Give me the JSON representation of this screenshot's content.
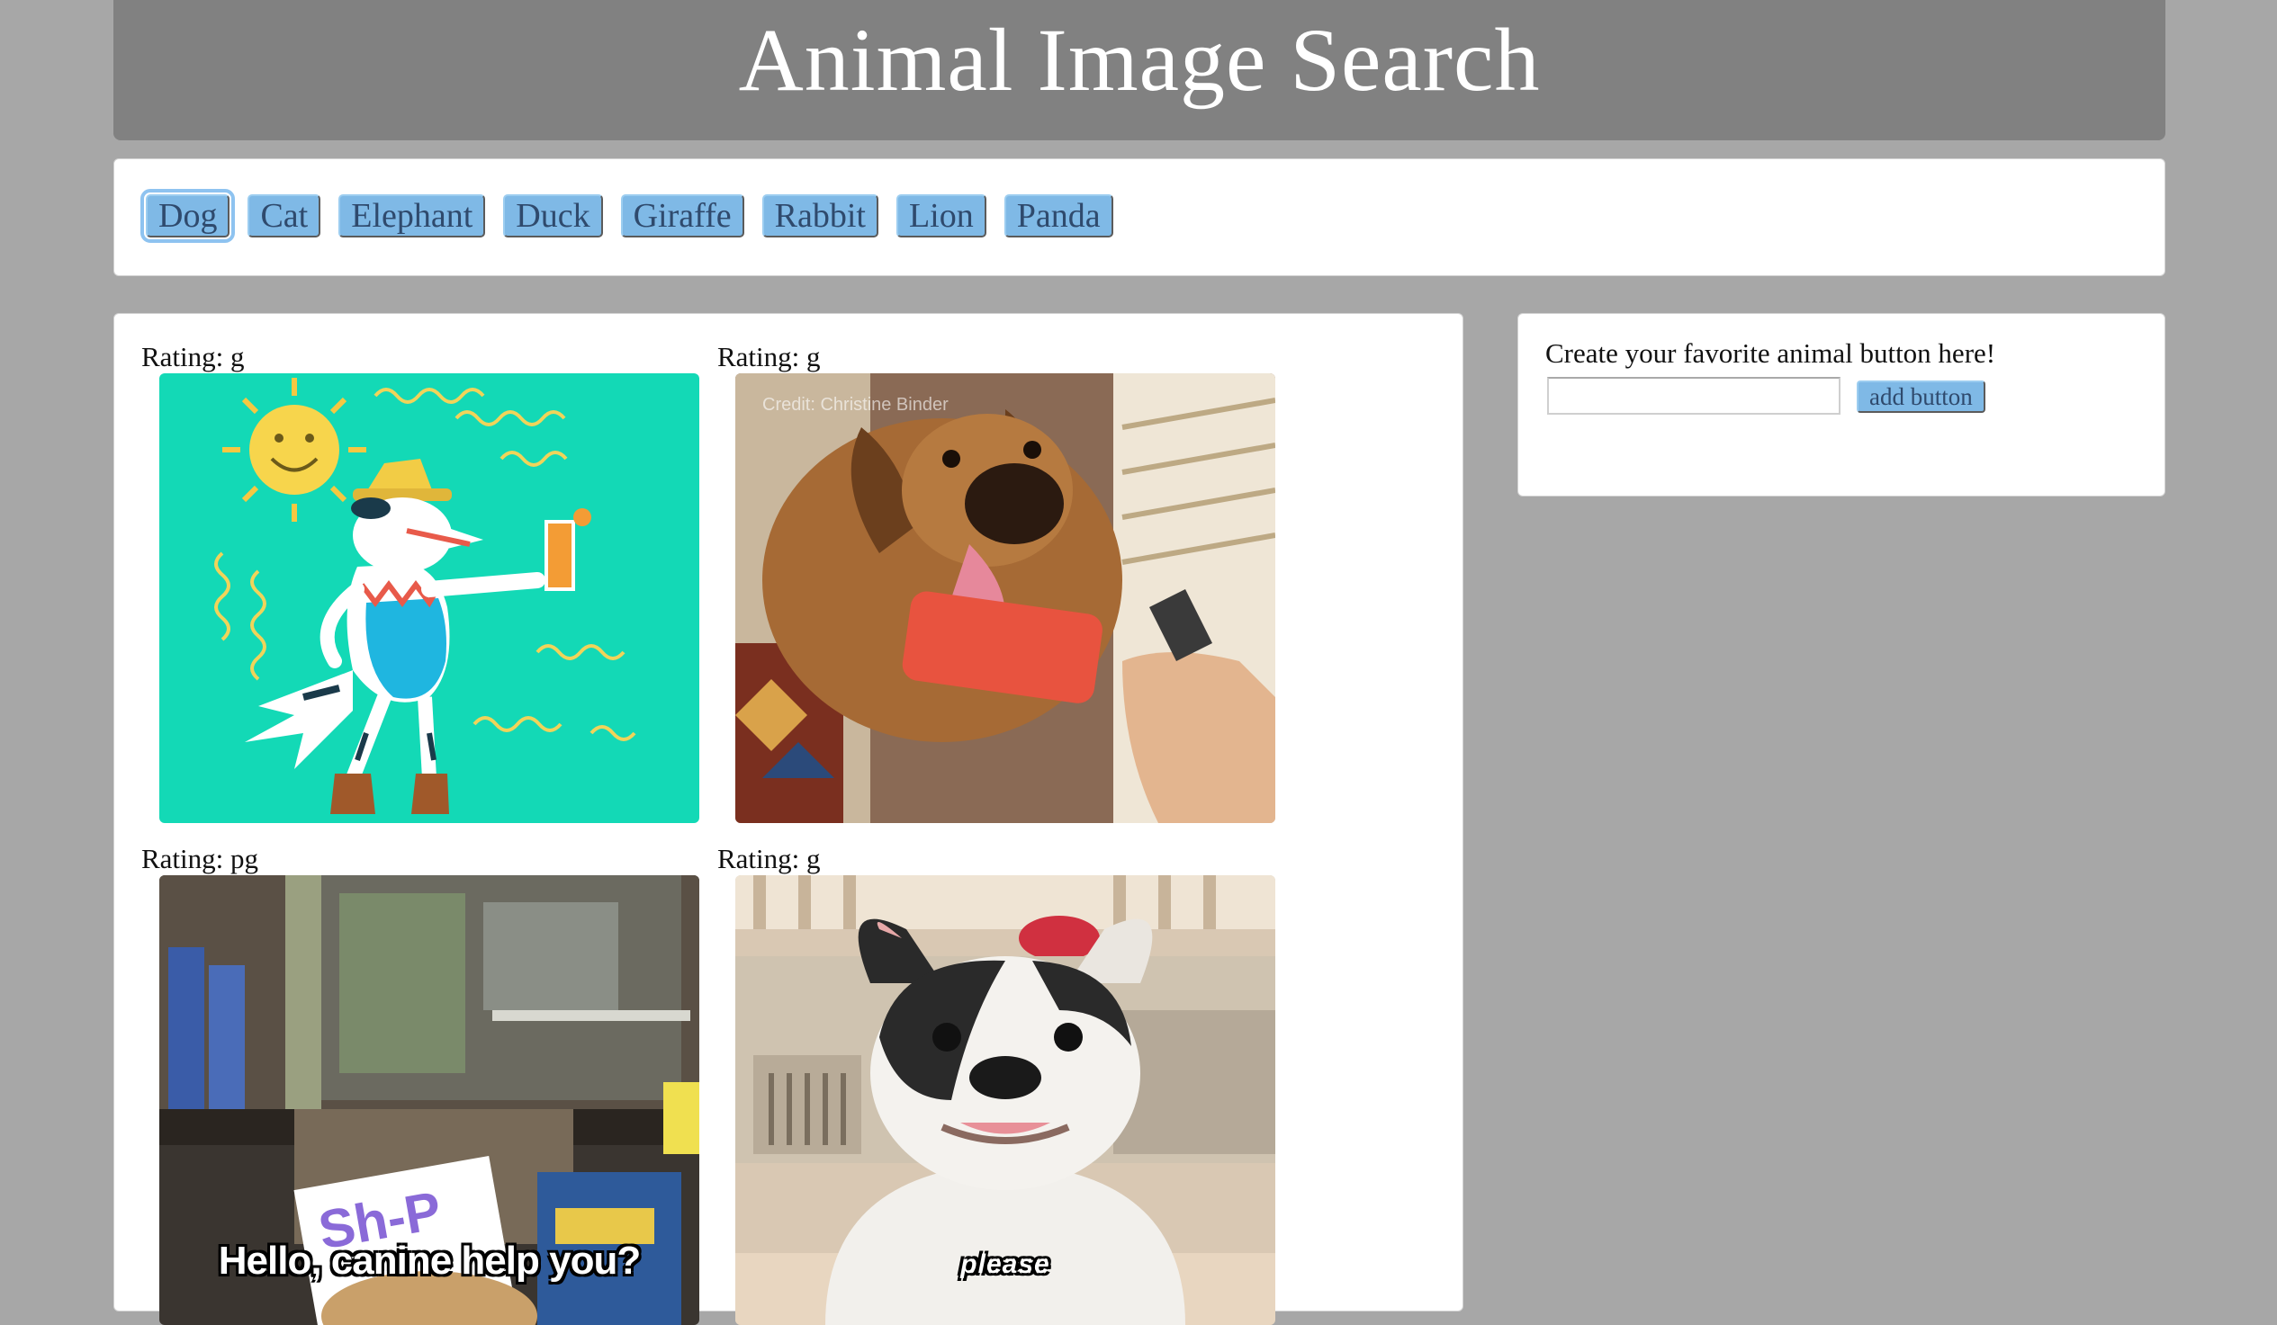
{
  "header": {
    "title": "Animal Image Search"
  },
  "buttons": [
    {
      "label": "Dog",
      "active": true
    },
    {
      "label": "Cat",
      "active": false
    },
    {
      "label": "Elephant",
      "active": false
    },
    {
      "label": "Duck",
      "active": false
    },
    {
      "label": "Giraffe",
      "active": false
    },
    {
      "label": "Rabbit",
      "active": false
    },
    {
      "label": "Lion",
      "active": false
    },
    {
      "label": "Panda",
      "active": false
    }
  ],
  "results": [
    {
      "rating": "Rating: g",
      "image": "cartoon-dog-dancing-gif"
    },
    {
      "rating": "Rating: g",
      "image": "dog-licking-popsicle-gif",
      "watermark": "Credit: Christine Binder"
    },
    {
      "rating": "Rating: pg",
      "image": "dog-at-shop-counter-gif",
      "caption": "Hello, canine help you?"
    },
    {
      "rating": "Rating: g",
      "image": "french-bulldog-gif",
      "caption": "please"
    }
  ],
  "sidebar": {
    "label": "Create your favorite animal button here!",
    "input_value": "",
    "add_button_label": "add button"
  },
  "colors": {
    "page_background": "#a7a7a7",
    "header_background": "#818181",
    "button_background": "#7fb9e6",
    "button_text": "#2f4a6d"
  }
}
